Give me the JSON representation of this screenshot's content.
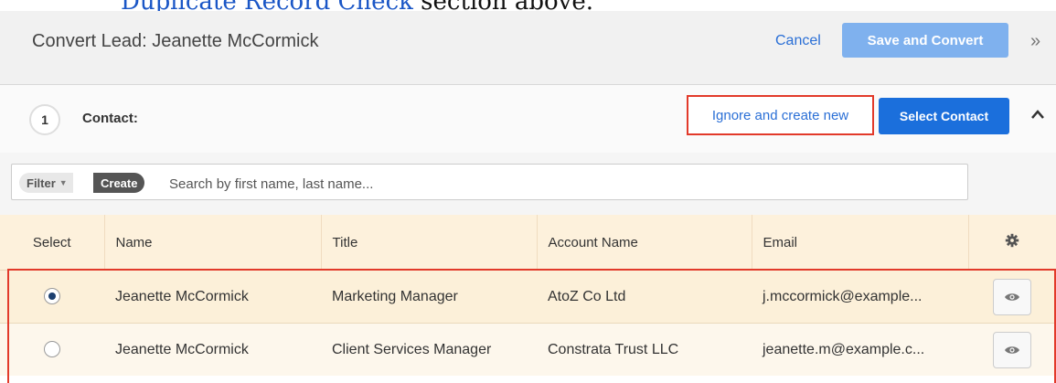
{
  "doc_snippet": {
    "link_text": "Duplicate Record Check",
    "trailing_text": " section above."
  },
  "header": {
    "title": "Convert Lead: Jeanette McCormick",
    "cancel_label": "Cancel",
    "save_label": "Save and Convert",
    "more_glyph": "»"
  },
  "contact_section": {
    "step_number": "1",
    "label": "Contact:",
    "ignore_label": "Ignore and create new",
    "select_label": "Select Contact",
    "collapse_glyph": "^"
  },
  "filter": {
    "filter_label": "Filter",
    "create_label": "Create",
    "search_placeholder": "Search by first name, last name..."
  },
  "table": {
    "columns": [
      "Select",
      "Name",
      "Title",
      "Account Name",
      "Email"
    ],
    "rows": [
      {
        "selected": true,
        "name": "Jeanette McCormick",
        "title": "Marketing Manager",
        "account": "AtoZ Co Ltd",
        "email": "j.mccormick@example..."
      },
      {
        "selected": false,
        "name": "Jeanette McCormick",
        "title": "Client Services Manager",
        "account": "Constrata Trust LLC",
        "email": "jeanette.m@example.c..."
      }
    ]
  },
  "colors": {
    "primary_button": "#1b6fdc",
    "disabled_button": "#7fb1ee",
    "highlight_border": "#e23a2a",
    "header_row_bg": "#fdf1dc"
  }
}
